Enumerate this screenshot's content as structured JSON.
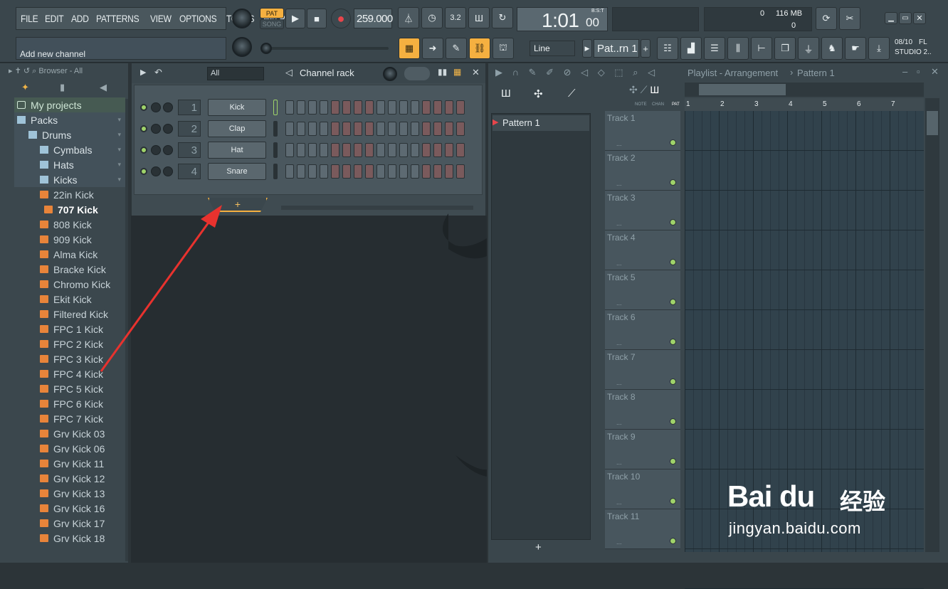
{
  "menu": [
    "FILE",
    "EDIT",
    "ADD",
    "PATTERNS",
    "VIEW",
    "OPTIONS",
    "TOOLS",
    "HELP"
  ],
  "hint": "Add new channel",
  "transport": {
    "pat": "PAT",
    "song": "SONG",
    "tempo": "259.000",
    "time": "1:01",
    "time_sub": "00",
    "bst": "B:S:T"
  },
  "memory": {
    "cpu": "0",
    "mem": "116 MB",
    "poly": "0"
  },
  "snap": "Line",
  "pattern_selector": "Pat..rn 1",
  "version": {
    "line1": "08/10",
    "line2": "FL",
    "line3": "STUDIO 2.."
  },
  "browser": {
    "title": "Browser - All",
    "items": [
      {
        "label": "My projects",
        "kind": "proj",
        "indent": 0
      },
      {
        "label": "Packs",
        "kind": "folder",
        "indent": 0
      },
      {
        "label": "Drums",
        "kind": "folder",
        "indent": 1
      },
      {
        "label": "Cymbals",
        "kind": "folder",
        "indent": 2
      },
      {
        "label": "Hats",
        "kind": "folder",
        "indent": 2
      },
      {
        "label": "Kicks",
        "kind": "folder",
        "indent": 2
      },
      {
        "label": "22in Kick",
        "kind": "file",
        "indent": 2
      },
      {
        "label": "707 Kick",
        "kind": "sel",
        "indent": 3
      },
      {
        "label": "808 Kick",
        "kind": "file",
        "indent": 2
      },
      {
        "label": "909 Kick",
        "kind": "file",
        "indent": 2
      },
      {
        "label": "Alma Kick",
        "kind": "file",
        "indent": 2
      },
      {
        "label": "Bracke Kick",
        "kind": "file",
        "indent": 2
      },
      {
        "label": "Chromo Kick",
        "kind": "file",
        "indent": 2
      },
      {
        "label": "Ekit Kick",
        "kind": "file",
        "indent": 2
      },
      {
        "label": "Filtered Kick",
        "kind": "file",
        "indent": 2
      },
      {
        "label": "FPC 1 Kick",
        "kind": "file",
        "indent": 2
      },
      {
        "label": "FPC 2 Kick",
        "kind": "file",
        "indent": 2
      },
      {
        "label": "FPC 3 Kick",
        "kind": "file",
        "indent": 2
      },
      {
        "label": "FPC 4 Kick",
        "kind": "file",
        "indent": 2
      },
      {
        "label": "FPC 5 Kick",
        "kind": "file",
        "indent": 2
      },
      {
        "label": "FPC 6 Kick",
        "kind": "file",
        "indent": 2
      },
      {
        "label": "FPC 7 Kick",
        "kind": "file",
        "indent": 2
      },
      {
        "label": "Grv Kick 03",
        "kind": "file",
        "indent": 2
      },
      {
        "label": "Grv Kick 06",
        "kind": "file",
        "indent": 2
      },
      {
        "label": "Grv Kick 11",
        "kind": "file",
        "indent": 2
      },
      {
        "label": "Grv Kick 12",
        "kind": "file",
        "indent": 2
      },
      {
        "label": "Grv Kick 13",
        "kind": "file",
        "indent": 2
      },
      {
        "label": "Grv Kick 16",
        "kind": "file",
        "indent": 2
      },
      {
        "label": "Grv Kick 17",
        "kind": "file",
        "indent": 2
      },
      {
        "label": "Grv Kick 18",
        "kind": "file",
        "indent": 2
      }
    ]
  },
  "channel_rack": {
    "title": "Channel rack",
    "filter": "All",
    "channels": [
      {
        "num": "1",
        "name": "Kick",
        "selected": true
      },
      {
        "num": "2",
        "name": "Clap",
        "selected": false
      },
      {
        "num": "3",
        "name": "Hat",
        "selected": false
      },
      {
        "num": "4",
        "name": "Snare",
        "selected": false
      }
    ],
    "add_label": "+"
  },
  "playlist": {
    "title": "Playlist - Arrangement",
    "pattern": "Pattern 1",
    "picker_items": [
      "Pattern 1"
    ],
    "add_label": "+",
    "col_labels": [
      "NOTE",
      "CHAN",
      "PAT"
    ],
    "ruler": [
      "1",
      "2",
      "3",
      "4",
      "5",
      "6",
      "7"
    ],
    "tracks": [
      "Track 1",
      "Track 2",
      "Track 3",
      "Track 4",
      "Track 5",
      "Track 6",
      "Track 7",
      "Track 8",
      "Track 9",
      "Track 10",
      "Track 11"
    ]
  },
  "watermark": {
    "brand": "Bai du",
    "cn": "经验",
    "url": "jingyan.baidu.com"
  },
  "colors": {
    "accent": "#f5b040",
    "arrow": "#e8322e",
    "led": "#9fd36a",
    "step_gray": "#5d6a72",
    "step_red": "#7a5a5c"
  }
}
